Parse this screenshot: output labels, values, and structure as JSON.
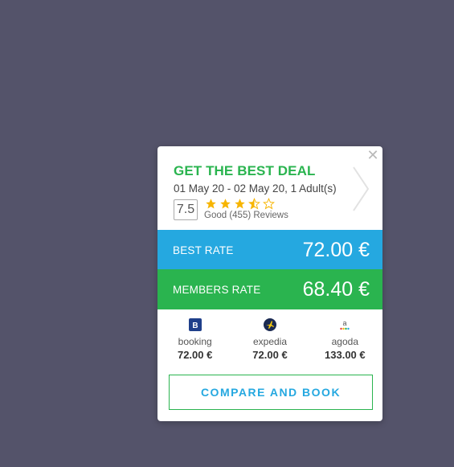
{
  "deal": {
    "title": "GET THE BEST DEAL",
    "dates": "01 May 20 - 02 May 20, 1 Adult(s)",
    "score": "7.5",
    "stars": 3.5,
    "reviews": "Good (455) Reviews"
  },
  "rates": {
    "best_label": "BEST RATE",
    "best_price": "72.00 €",
    "members_label": "MEMBERS RATE",
    "members_price": "68.40 €"
  },
  "providers": [
    {
      "name": "booking",
      "price": "72.00 €",
      "icon": "booking-logo"
    },
    {
      "name": "expedia",
      "price": "72.00 €",
      "icon": "expedia-logo"
    },
    {
      "name": "agoda",
      "price": "133.00 €",
      "icon": "agoda-logo"
    }
  ],
  "cta": "COMPARE AND BOOK",
  "colors": {
    "background": "#54536a",
    "green": "#2ab44f",
    "blue": "#25a8e0",
    "star": "#f7b500"
  }
}
